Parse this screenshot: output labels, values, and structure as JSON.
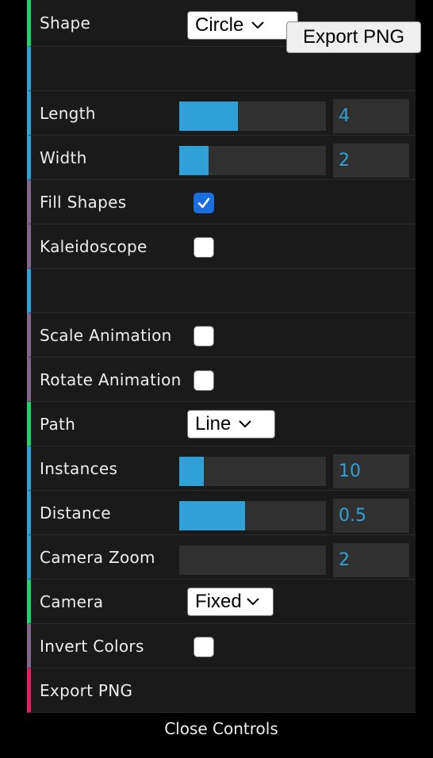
{
  "export_button": {
    "label": "Export PNG"
  },
  "controls": {
    "shape": {
      "label": "Shape",
      "value": "Circle"
    },
    "length": {
      "label": "Length",
      "value": "4",
      "fill_fraction": 0.4
    },
    "width": {
      "label": "Width",
      "value": "2",
      "fill_fraction": 0.2
    },
    "fill_shapes": {
      "label": "Fill Shapes",
      "checked": true
    },
    "kaleidoscope": {
      "label": "Kaleidoscope",
      "checked": false
    },
    "scale_animation": {
      "label": "Scale Animation",
      "checked": false
    },
    "rotate_animation": {
      "label": "Rotate Animation",
      "checked": false
    },
    "path": {
      "label": "Path",
      "value": "Line"
    },
    "instances": {
      "label": "Instances",
      "value": "10",
      "fill_fraction": 0.17
    },
    "distance": {
      "label": "Distance",
      "value": "0.5",
      "fill_fraction": 0.45
    },
    "camera_zoom": {
      "label": "Camera Zoom",
      "value": "2",
      "fill_fraction": 0.0
    },
    "camera": {
      "label": "Camera",
      "value": "Fixed"
    },
    "invert_colors": {
      "label": "Invert Colors",
      "checked": false
    },
    "export_png": {
      "label": "Export PNG"
    }
  },
  "close_controls": "Close Controls",
  "colors": {
    "panel_bg": "#1a1a1a",
    "number_accent": "#2fa1d6",
    "string_accent": "#1ed36f",
    "boolean_accent": "#806787",
    "function_accent": "#e61d5f"
  }
}
